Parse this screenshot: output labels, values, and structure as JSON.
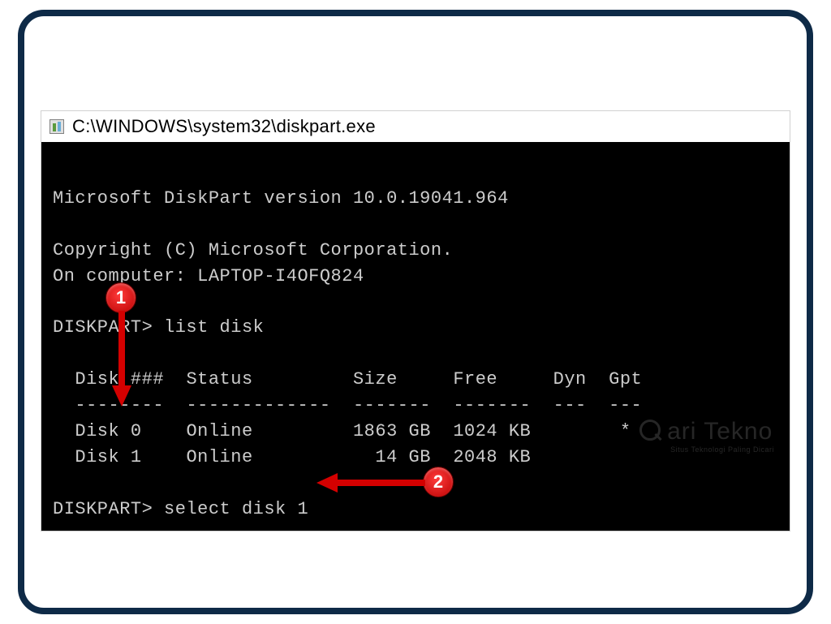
{
  "window": {
    "title": "C:\\WINDOWS\\system32\\diskpart.exe"
  },
  "terminal": {
    "intro_line1": "Microsoft DiskPart version 10.0.19041.964",
    "intro_copyright": "Copyright (C) Microsoft Corporation.",
    "intro_computer": "On computer: LAPTOP-I4OFQ824",
    "prompt": "DISKPART>",
    "cmd1": "list disk",
    "cmd2": "select disk 1",
    "table": {
      "header_disk": "Disk ###",
      "header_status": "Status",
      "header_size": "Size",
      "header_free": "Free",
      "header_dyn": "Dyn",
      "header_gpt": "Gpt",
      "sep_disk": "--------",
      "sep_status": "-------------",
      "sep_size": "-------",
      "sep_free": "-------",
      "sep_dyn": "---",
      "sep_gpt": "---",
      "row0_disk": "Disk 0",
      "row0_status": "Online",
      "row0_size": "1863 GB",
      "row0_free": "1024 KB",
      "row0_dyn": "",
      "row0_gpt": "*",
      "row1_disk": "Disk 1",
      "row1_status": "Online",
      "row1_size": "14 GB",
      "row1_free": "2048 KB",
      "row1_dyn": "",
      "row1_gpt": ""
    }
  },
  "annotations": {
    "badge1": "1",
    "badge2": "2"
  },
  "watermark": {
    "main": "ari Tekno",
    "sub": "Situs Teknologi Paling Dicari"
  }
}
